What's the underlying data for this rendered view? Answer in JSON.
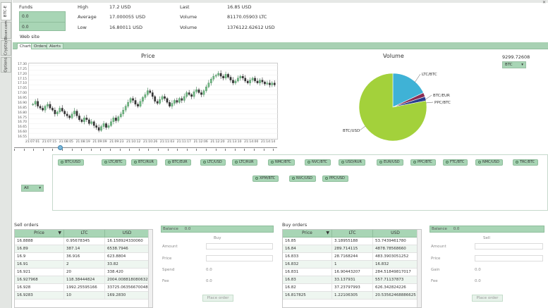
{
  "side_tabs": [
    "BTC-E",
    "Btcer.com",
    "Cryptsy",
    "Options"
  ],
  "stats": {
    "funds_label": "Funds",
    "funds_values": [
      "0.0",
      "0.0"
    ],
    "website_label": "Web site",
    "high_label": "High",
    "high_value": "17.2 USD",
    "average_label": "Average",
    "average_value": "17.000055 USD",
    "low_label": "Low",
    "low_value": "16.80011 USD",
    "last_label": "Last",
    "last_value": "16.85 USD",
    "volume1_label": "Volume",
    "volume1_value": "81170.05903 LTC",
    "volume2_label": "Volume",
    "volume2_value": "1376122.62612 USD"
  },
  "tabs": [
    "Charts",
    "Orders",
    "Alerts"
  ],
  "price_chart": {
    "title": "Price",
    "y_ticks": [
      "17.30",
      "17.25",
      "17.20",
      "17.15",
      "17.10",
      "17.05",
      "17.00",
      "16.95",
      "16.90",
      "16.85",
      "16.80",
      "16.75",
      "16.70",
      "16.65",
      "16.60",
      "16.55"
    ],
    "x_ticks": [
      "21:07:01",
      "21:07:15",
      "21:08:05",
      "21:08:19",
      "21:09:09",
      "21:09:23",
      "21:10:12",
      "21:10:26",
      "21:11:03",
      "21:11:17",
      "21:12:06",
      "21:12:20",
      "21:13:10",
      "21:14:00",
      "21:14:14"
    ],
    "close": [
      16.9,
      16.93,
      16.88,
      16.86,
      16.84,
      16.88,
      16.9,
      16.86,
      16.84,
      16.8,
      16.82,
      16.86,
      16.83,
      16.8,
      16.78,
      16.76,
      16.8,
      16.83,
      16.78,
      16.74,
      16.72,
      16.76,
      16.74,
      16.7,
      16.72,
      16.68,
      16.66,
      16.63,
      16.67,
      16.7,
      16.66,
      16.68,
      16.72,
      16.76,
      16.73,
      16.77,
      16.8,
      16.84,
      16.88,
      16.92,
      16.96,
      16.94,
      16.9,
      16.88,
      16.93,
      16.97,
      17.0,
      17.04,
      17.02,
      16.98,
      16.93,
      16.91,
      16.95,
      16.98,
      16.96,
      16.92,
      16.88,
      16.91,
      16.94,
      16.92,
      16.96,
      16.94,
      16.98,
      17.02,
      17.0,
      16.98,
      17.03,
      17.05,
      17.02,
      17.0,
      17.04,
      17.08,
      17.12,
      17.16,
      17.19,
      17.2,
      17.22,
      17.19,
      17.17,
      17.21,
      17.18,
      17.15,
      17.12,
      17.14,
      17.17,
      17.19,
      17.17,
      17.14,
      17.12,
      17.15,
      17.17,
      17.14,
      17.12,
      17.15,
      17.13,
      17.11,
      17.12,
      17.1,
      17.12,
      17.1
    ]
  },
  "volume_chart": {
    "title": "Volume",
    "value": "9299.72608",
    "selected": "BTC",
    "slices": [
      {
        "label": "BTC/USD",
        "value": 78,
        "color": "#a3d13b"
      },
      {
        "label": "LTC/BTC",
        "value": 18,
        "color": "#3fb2d6"
      },
      {
        "label": "BTC/EUR",
        "value": 2,
        "color": "#8b2c52"
      },
      {
        "label": "PPC/BTC",
        "value": 2,
        "color": "#2a3f8f"
      }
    ]
  },
  "filter": {
    "selected": "All",
    "chips": [
      "BTC/USD",
      "LTC/BTC",
      "BTC/RUR",
      "BTC/EUR",
      "LTC/USD",
      "LTC/RUR",
      "NMC/BTC",
      "NVC/BTC",
      "USD/RUR",
      "EUR/USD",
      "PPC/BTC",
      "FTC/BTC",
      "NMC/USD",
      "TRC/BTC",
      "XPM/BTC",
      "NVC/USD",
      "PPC/USD"
    ]
  },
  "sell_orders": {
    "title": "Sell orders",
    "columns": [
      "Price",
      "LTC",
      "USD"
    ],
    "rows": [
      [
        "16.8888",
        "0.95678345",
        "16.158924330060"
      ],
      [
        "16.89",
        "387.14",
        "6538.7946"
      ],
      [
        "16.9",
        "36.916",
        "623.8804"
      ],
      [
        "16.91",
        "2",
        "33.82"
      ],
      [
        "16.921",
        "20",
        "338.420"
      ],
      [
        "16.927968",
        "118.38444824",
        "2004.008818080632"
      ],
      [
        "16.928",
        "1992.25595166",
        "33725.06356670048"
      ],
      [
        "16.9283",
        "10",
        "169.2830"
      ]
    ]
  },
  "buy_orders": {
    "title": "Buy orders",
    "columns": [
      "Price",
      "LTC",
      "USD"
    ],
    "rows": [
      [
        "16.85",
        "3.18955188",
        "53.7439461780"
      ],
      [
        "16.84",
        "289.714115",
        "4878.78568660"
      ],
      [
        "16.833",
        "28.7168244",
        "483.3903051252"
      ],
      [
        "16.832",
        "1",
        "16.832"
      ],
      [
        "16.831",
        "16.90443207",
        "284.51849817017"
      ],
      [
        "16.83",
        "33.137931",
        "557.71137873"
      ],
      [
        "16.82",
        "37.23797993",
        "626.342824226"
      ],
      [
        "16.817825",
        "1.22106305",
        "20.53562468886625"
      ]
    ]
  },
  "buy_form": {
    "balance_label": "Balance",
    "balance_value": "0.0",
    "header": "Buy",
    "amount_label": "Amount",
    "price_label": "Price",
    "spend_label": "Spend",
    "spend_value": "0.0",
    "fee_label": "Fee",
    "fee_value": "0.0",
    "button": "Place order"
  },
  "sell_form": {
    "balance_label": "Balance",
    "balance_value": "0.0",
    "header": "Sell",
    "amount_label": "Amount",
    "price_label": "Price",
    "gain_label": "Gain",
    "gain_value": "0.0",
    "fee_label": "Fee",
    "fee_value": "0.0",
    "button": "Place order"
  },
  "colors": {
    "accent": "#a8d5b5",
    "candle_up": "#3f7d52",
    "candle_down": "#2d2d2d"
  }
}
